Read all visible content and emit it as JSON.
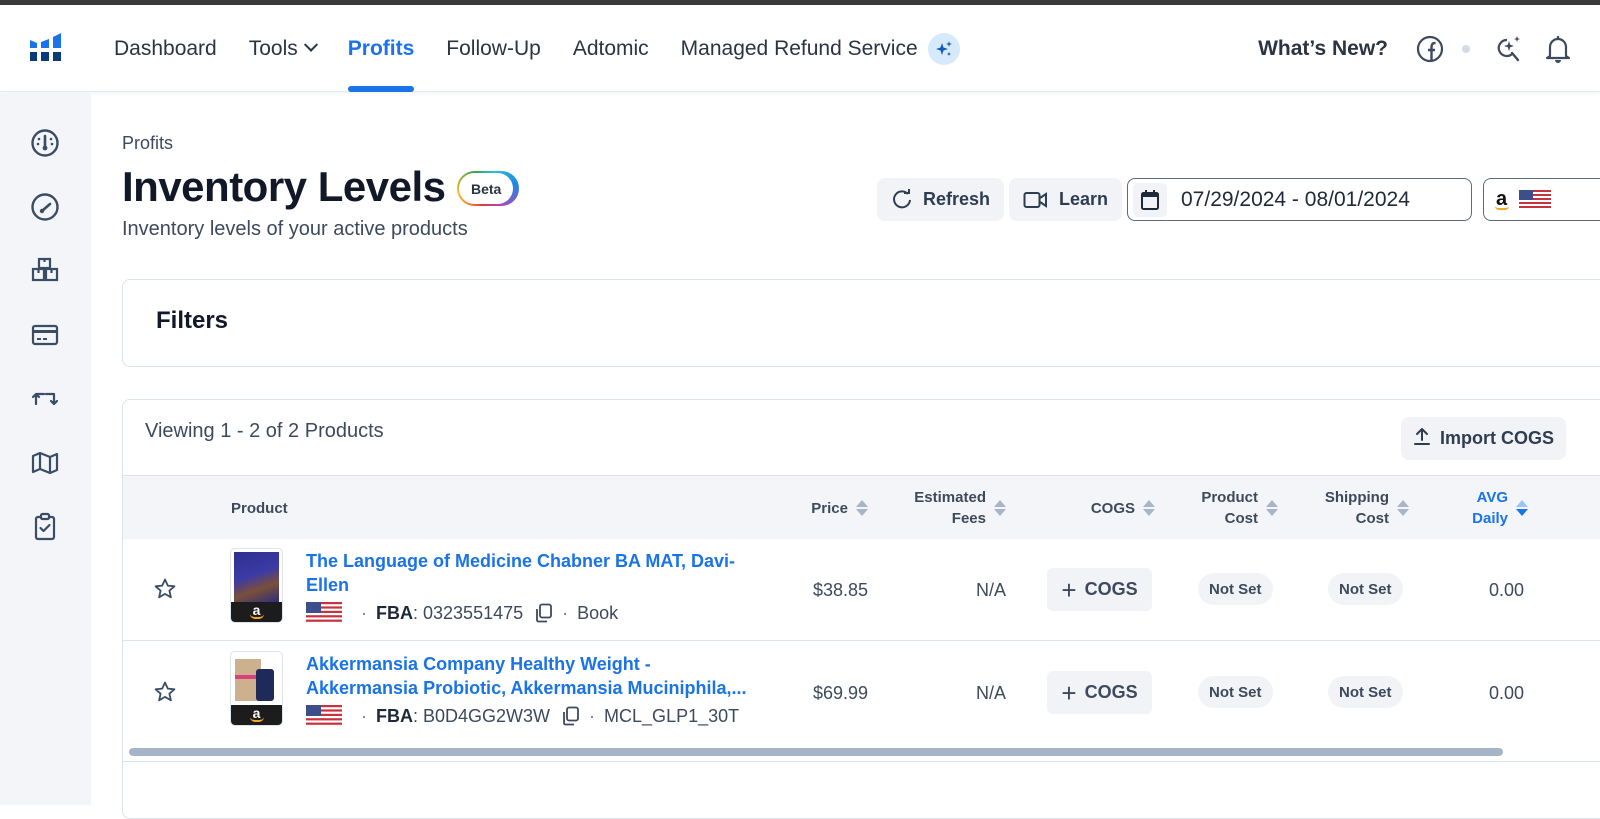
{
  "nav": {
    "items": [
      {
        "label": "Dashboard",
        "active": false
      },
      {
        "label": "Tools",
        "active": false,
        "has_dropdown": true
      },
      {
        "label": "Profits",
        "active": true
      },
      {
        "label": "Follow-Up",
        "active": false
      },
      {
        "label": "Adtomic",
        "active": false
      },
      {
        "label": "Managed Refund Service",
        "active": false,
        "badge_icon": "sparkle-icon"
      }
    ],
    "whats_new": "What’s New?",
    "right_icons": [
      "facebook-icon",
      "ai-search-icon",
      "bell-icon"
    ]
  },
  "sidebar": {
    "items": [
      {
        "icon": "dashboard-gauge-icon"
      },
      {
        "icon": "speedometer-icon"
      },
      {
        "icon": "boxes-icon"
      },
      {
        "icon": "credit-card-icon"
      },
      {
        "icon": "refund-arrows-icon"
      },
      {
        "icon": "map-icon"
      },
      {
        "icon": "clipboard-check-icon"
      }
    ]
  },
  "page": {
    "breadcrumb": "Profits",
    "title": "Inventory Levels",
    "badge": "Beta",
    "subtitle": "Inventory levels of your active products"
  },
  "toolbar": {
    "refresh_label": "Refresh",
    "learn_label": "Learn",
    "date_range": "07/29/2024 - 08/01/2024",
    "marketplace": "Amazon US"
  },
  "filters": {
    "title": "Filters"
  },
  "table": {
    "viewing_text": "Viewing 1 - 2 of 2 Products",
    "import_label": "Import COGS",
    "columns": [
      {
        "line1": "Product",
        "line2": ""
      },
      {
        "line1": "Price",
        "line2": ""
      },
      {
        "line1": "Estimated",
        "line2": "Fees"
      },
      {
        "line1": "COGS",
        "line2": ""
      },
      {
        "line1": "Product",
        "line2": "Cost"
      },
      {
        "line1": "Shipping",
        "line2": "Cost"
      },
      {
        "line1": "AVG",
        "line2": "Daily"
      }
    ],
    "sorted_column": "AVG Daily",
    "sort_direction": "descending",
    "rows": [
      {
        "title": "The Language of Medicine Chabner BA MAT, Davi-Ellen",
        "channel_label": "FBA",
        "asin": "0323551475",
        "category": "Book",
        "price": "$38.85",
        "est_fees": "N/A",
        "cogs_label": "COGS",
        "product_cost": "Not Set",
        "shipping_cost": "Not Set",
        "avg_daily": "0.00",
        "favorited": false
      },
      {
        "title": "Akkermansia Company Healthy Weight - Akkermansia Probiotic, Akkermansia Muciniphila,...",
        "channel_label": "FBA",
        "asin": "B0D4GG2W3W",
        "category": "MCL_GLP1_30T",
        "price": "$69.99",
        "est_fees": "N/A",
        "cogs_label": "COGS",
        "product_cost": "Not Set",
        "shipping_cost": "Not Set",
        "avg_daily": "0.00",
        "favorited": false
      }
    ]
  },
  "colors": {
    "accent": "#1a73e8",
    "text_primary": "#111827",
    "text_secondary": "#3d4a5c",
    "sidebar_bg": "#f3f5f8",
    "logo_light": "#1a73e8",
    "logo_dark": "#0a3a78"
  }
}
